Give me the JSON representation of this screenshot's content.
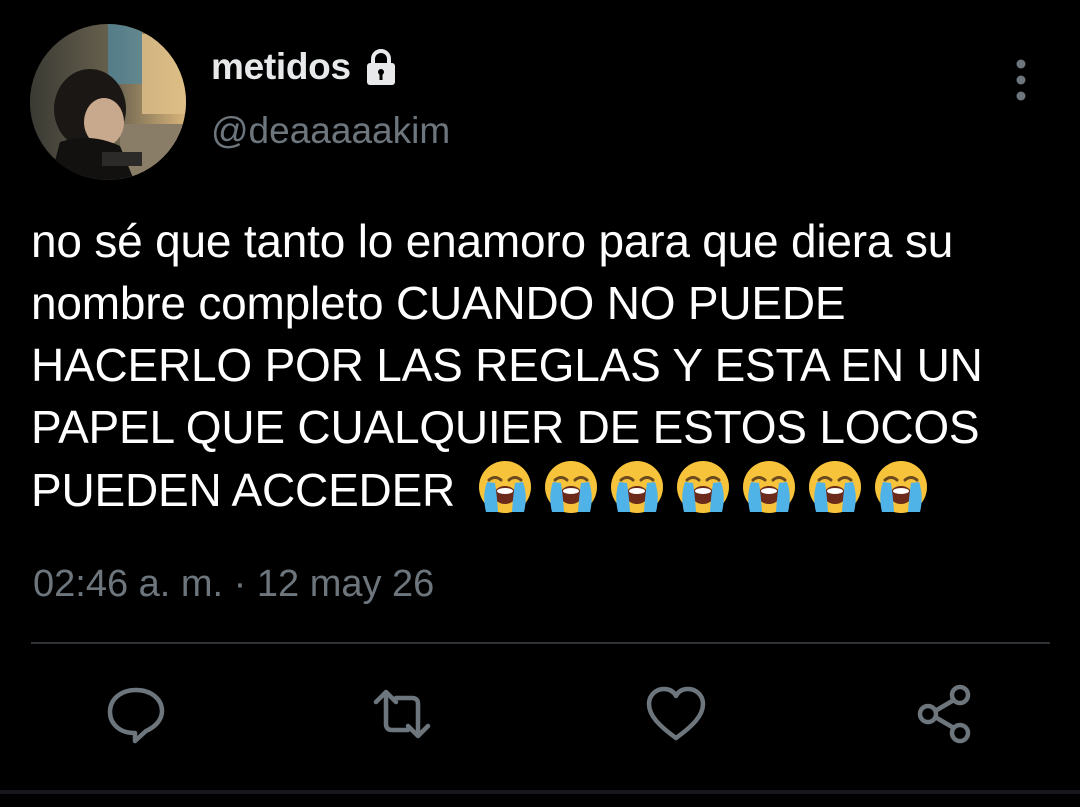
{
  "user": {
    "display_name": "metidos",
    "handle": "@deaaaaakim",
    "avatar_icon": "profile-photo",
    "protected_icon": "lock-icon"
  },
  "tweet": {
    "text": "no sé que tanto lo enamoro para que diera su nombre completo CUANDO NO PUEDE HACERLO POR LAS REGLAS Y ESTA EN UN PAPEL QUE CUALQUIER DE ESTOS LOCOS PUEDEN ACCEDER",
    "emoji_name": "loudly-crying-face",
    "emoji_count": 7,
    "timestamp": "02:46 a. m. · 12 may 26"
  },
  "actions": {
    "reply_icon": "reply-icon",
    "retweet_icon": "retweet-icon",
    "like_icon": "heart-icon",
    "share_icon": "share-icon",
    "more_icon": "more-vertical-icon"
  },
  "colors": {
    "background": "#000000",
    "primary_text": "#ffffff",
    "secondary_text": "#6e767d",
    "divider": "#2f3336",
    "icon": "#6e767d"
  }
}
